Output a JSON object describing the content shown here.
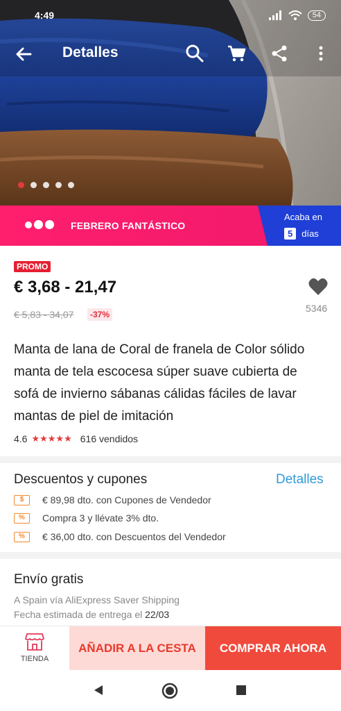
{
  "status": {
    "time": "4:49",
    "battery": "54"
  },
  "appbar": {
    "title": "Detalles"
  },
  "gallery": {
    "image_count": 5,
    "active_index": 0
  },
  "promo_banner": {
    "label": "FEBRERO FANTÁSTICO",
    "countdown_prefix": "Acaba en",
    "countdown_days": "5",
    "countdown_unit": "días"
  },
  "product": {
    "tag": "PROMO",
    "price": "€ 3,68 - 21,47",
    "old_price": "€ 5,83 - 34,07",
    "discount": "-37%",
    "wishlist_count": "5346",
    "title": "Manta de lana de Coral de franela de Color sólido manta de tela escocesa súper suave cubierta de sofá de invierno sábanas cálidas fáciles de lavar mantas de piel de imitación",
    "rating": "4.6",
    "stars": "★★★★★",
    "sold": "616 vendidos"
  },
  "coupons": {
    "title": "Descuentos y cupones",
    "link": "Detalles",
    "items": [
      {
        "icon": "$",
        "text": "€ 89,98 dto. con Cupones de Vendedor"
      },
      {
        "icon": "%",
        "text": "Compra 3 y llévate 3% dto."
      },
      {
        "icon": "%",
        "text": "€ 36,00 dto. con Descuentos del Vendedor"
      }
    ]
  },
  "shipping": {
    "title": "Envío gratis",
    "route": "A Spain vía AliExpress Saver Shipping",
    "eta_label": "Fecha estimada de entrega el",
    "eta_date": "22/03"
  },
  "actions": {
    "store_label": "TIENDA",
    "add_to_cart": "AÑADIR A LA CESTA",
    "buy_now": "COMPRAR AHORA"
  },
  "colors": {
    "promo_pink": "#f0186c",
    "countdown_blue": "#1f3fd6",
    "price_red": "#e51e32",
    "link_blue": "#2f9bd8",
    "buy_button": "#f04a3d",
    "cart_button_bg": "#fddad6"
  }
}
